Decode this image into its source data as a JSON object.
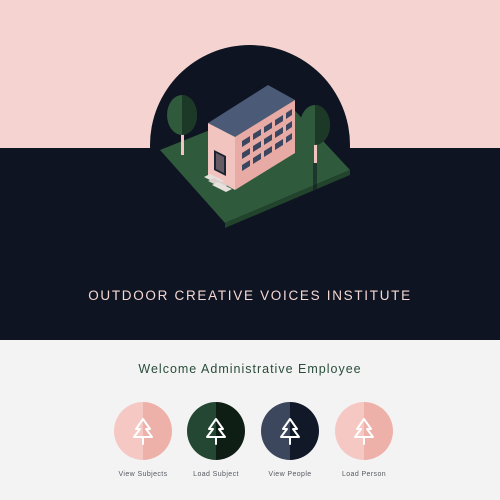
{
  "header": {
    "institute_title": "OUTDOOR CREATIVE VOICES INSTITUTE"
  },
  "main": {
    "welcome_title": "Welcome Administrative Employee",
    "actions": [
      {
        "label": "View Subjects",
        "icon": "pine-tree-icon",
        "color_left": "#f6c8c4",
        "color_right": "#eeb1aa"
      },
      {
        "label": "Load Subject",
        "icon": "pine-tree-icon",
        "color_left": "#244733",
        "color_right": "#0f1e14"
      },
      {
        "label": "View People",
        "icon": "pine-tree-icon",
        "color_left": "#3c475e",
        "color_right": "#111928"
      },
      {
        "label": "Load Person",
        "icon": "pine-tree-icon",
        "color_left": "#f6c8c4",
        "color_right": "#eeb1aa"
      }
    ]
  },
  "colors": {
    "pink": "#f5d3d0",
    "navy": "#0e1421",
    "green": "#2a4d3b",
    "light_gray": "#f3f3f3"
  }
}
